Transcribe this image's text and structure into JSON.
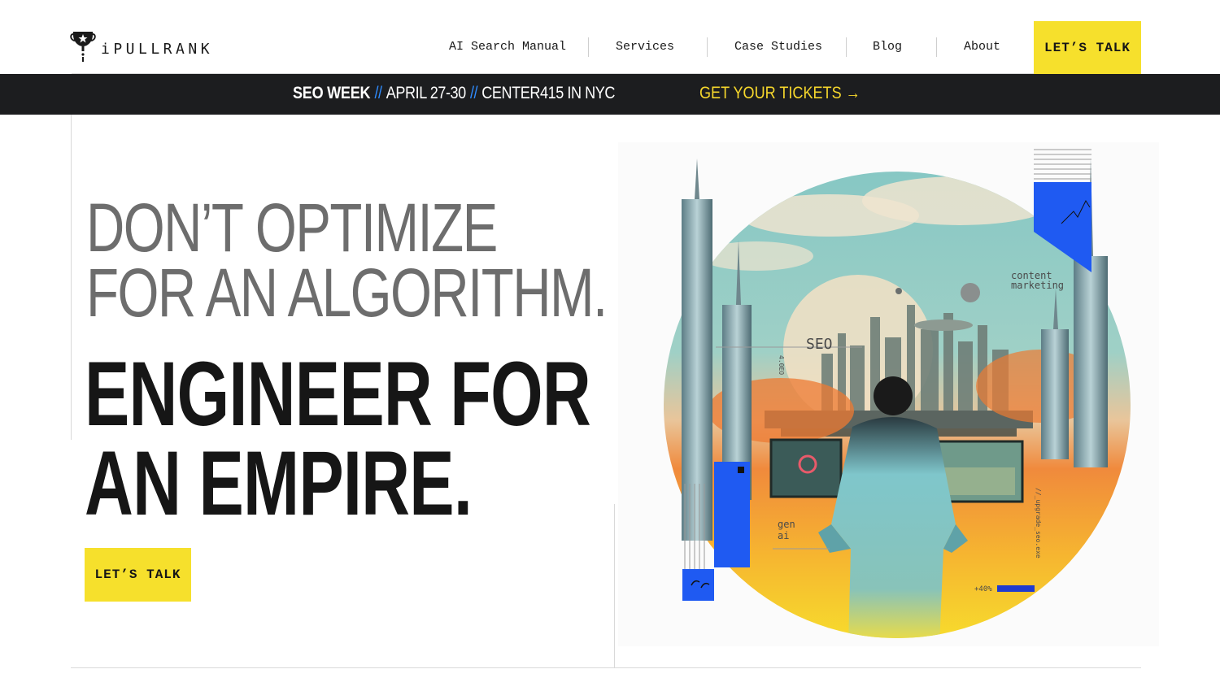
{
  "brand": {
    "name": "iPULLRANK",
    "logo_icon": "trophy-icon"
  },
  "nav": {
    "items": [
      {
        "label": "AI Search Manual"
      },
      {
        "label": "Services"
      },
      {
        "label": "Case Studies"
      },
      {
        "label": "Blog"
      },
      {
        "label": "About"
      }
    ],
    "cta_label": "LET’S TALK"
  },
  "banner": {
    "event": "SEO WEEK",
    "separator": "//",
    "dates": "APRIL 27-30",
    "venue": "CENTER415 IN NYC",
    "cta": "GET YOUR TICKETS →"
  },
  "hero": {
    "headline_light_1": "DON’T OPTIMIZE",
    "headline_light_2": "FOR AN ALGORITHM.",
    "headline_bold_1": "ENGINEER FOR",
    "headline_bold_2": "AN EMPIRE.",
    "cta_label": "LET’S TALK",
    "image_labels": {
      "content": "content",
      "marketing": "marketing",
      "seo": "SEO",
      "gen": "gen",
      "ai": "ai",
      "upgrade": "//_upgrade_seo.exe",
      "percent": "+40%",
      "side_code": "4.0EO"
    }
  },
  "colors": {
    "accent_yellow": "#f6e02c",
    "banner_bg": "#1c1d1f",
    "banner_slash": "#2f8cff",
    "banner_cta": "#f6d72c",
    "art_blue": "#1f5af2"
  }
}
